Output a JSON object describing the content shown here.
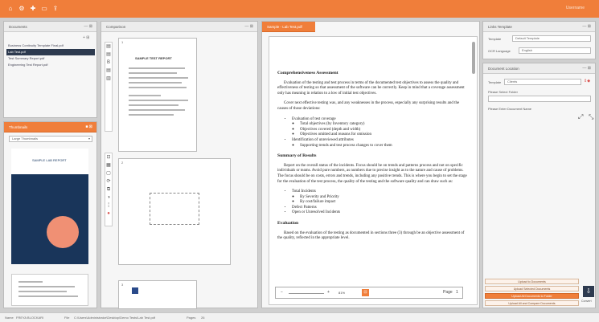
{
  "titlebar": {
    "icons": [
      "home-icon",
      "gear-icon",
      "add-user-icon",
      "folder-icon",
      "export-icon"
    ],
    "user_label": "Username"
  },
  "documents_panel": {
    "title": "Documents",
    "items": [
      {
        "label": "Business Continuity Template Final.pdf",
        "selected": false
      },
      {
        "label": "Lab Test.pdf",
        "selected": true
      },
      {
        "label": "Test Summary Report.pdf",
        "selected": false
      },
      {
        "label": "Engineering Test Report.pdf",
        "selected": false
      }
    ]
  },
  "thumbnails_panel": {
    "title": "Thumbnails",
    "filter_value": "Large Thumbnails",
    "cover_title": "SAMPLE LAB REPORT"
  },
  "comparison_panel": {
    "title": "Comparison",
    "pages": [
      {
        "number": "1",
        "heading": "SAMPLE TEST REPORT"
      },
      {
        "number": "2",
        "heading": ""
      },
      {
        "number": "3",
        "heading": ""
      }
    ]
  },
  "document_view": {
    "tab_title": "Sample - Lab Test.pdf",
    "heading1": "Comprehensiveness Assessment",
    "para1": "Evaluation of the testing and test process in terms of the documented test objectives to assess the quality and effectiveness of testing so that assessment of the software can be correctly. Keep in mind that a coverage assessment only has meaning in relation to a low of initial test objectives.",
    "para2": "Cover next effective testing was, and any weaknesses in the process, especially any surprising results and the causes of those deviations:",
    "bullets1": [
      {
        "text": "Evaluation of test coverage",
        "sub": [
          "Total objectives (by Inventory category)",
          "Objectives covered (depth and width)",
          "Objectives omitted and reasons for omission"
        ]
      },
      {
        "text": "Identification of unreviewed attributes",
        "sub": [
          "Supporting trends and test process changes to cover them"
        ]
      }
    ],
    "heading2": "Summary of Results",
    "para3": "Report on the overall status of the incidents. Focus should be on trends and patterns process and not on specific individuals or teams. Avoid pure numbers, as numbers due to precise insight as to the nature and cause of problems. The focus should be on costs, errors and trends, including any positive trends. This is where you begin to set the stage for the evaluation of the test process, the quality of the testing and the software quality and can draw such as:",
    "bullets2": [
      {
        "text": "Total Incidents",
        "sub": [
          "By Severity and Priority",
          "By cost/failure impact"
        ]
      },
      {
        "text": "Defect Patterns",
        "sub": []
      },
      {
        "text": "Open or Unresolved Incidents",
        "sub": []
      }
    ],
    "heading3": "Evaluation",
    "para4": "Based on the evaluation of the testing as documented in sections three (3) through be an objective assessment of the quality, reflected in the appropriate level.",
    "zoom": {
      "minus": "−",
      "plus": "+",
      "value": "81%",
      "page_label": "Page",
      "page_value": "1"
    }
  },
  "settings_panel": {
    "title": "Links Template",
    "template_label": "Template",
    "template_value": "Default Template",
    "language_label": "OCR Language",
    "language_value": "English"
  },
  "details_panel": {
    "title": "Document Location",
    "template_label": "Template",
    "template_value": "Clients",
    "folder_label": "Please Select Folder",
    "name_label": "Please Enter Document Name"
  },
  "actions": {
    "btn1": "Upload to Documents",
    "btn2": "Upload Selected Documents",
    "btn3": "Upload All Documents to Folder",
    "btn4": "Upload All and Compare Documents",
    "side_label": "Convert"
  },
  "statusbar": {
    "name_label": "Name",
    "name_value": "FREYA BLOCKARI",
    "file_label": "File",
    "file_value": "C:\\Users\\Administrator\\Desktop\\Demo Tests\\Lab Test.pdf",
    "pages_label": "Pages",
    "pages_value": "26"
  }
}
